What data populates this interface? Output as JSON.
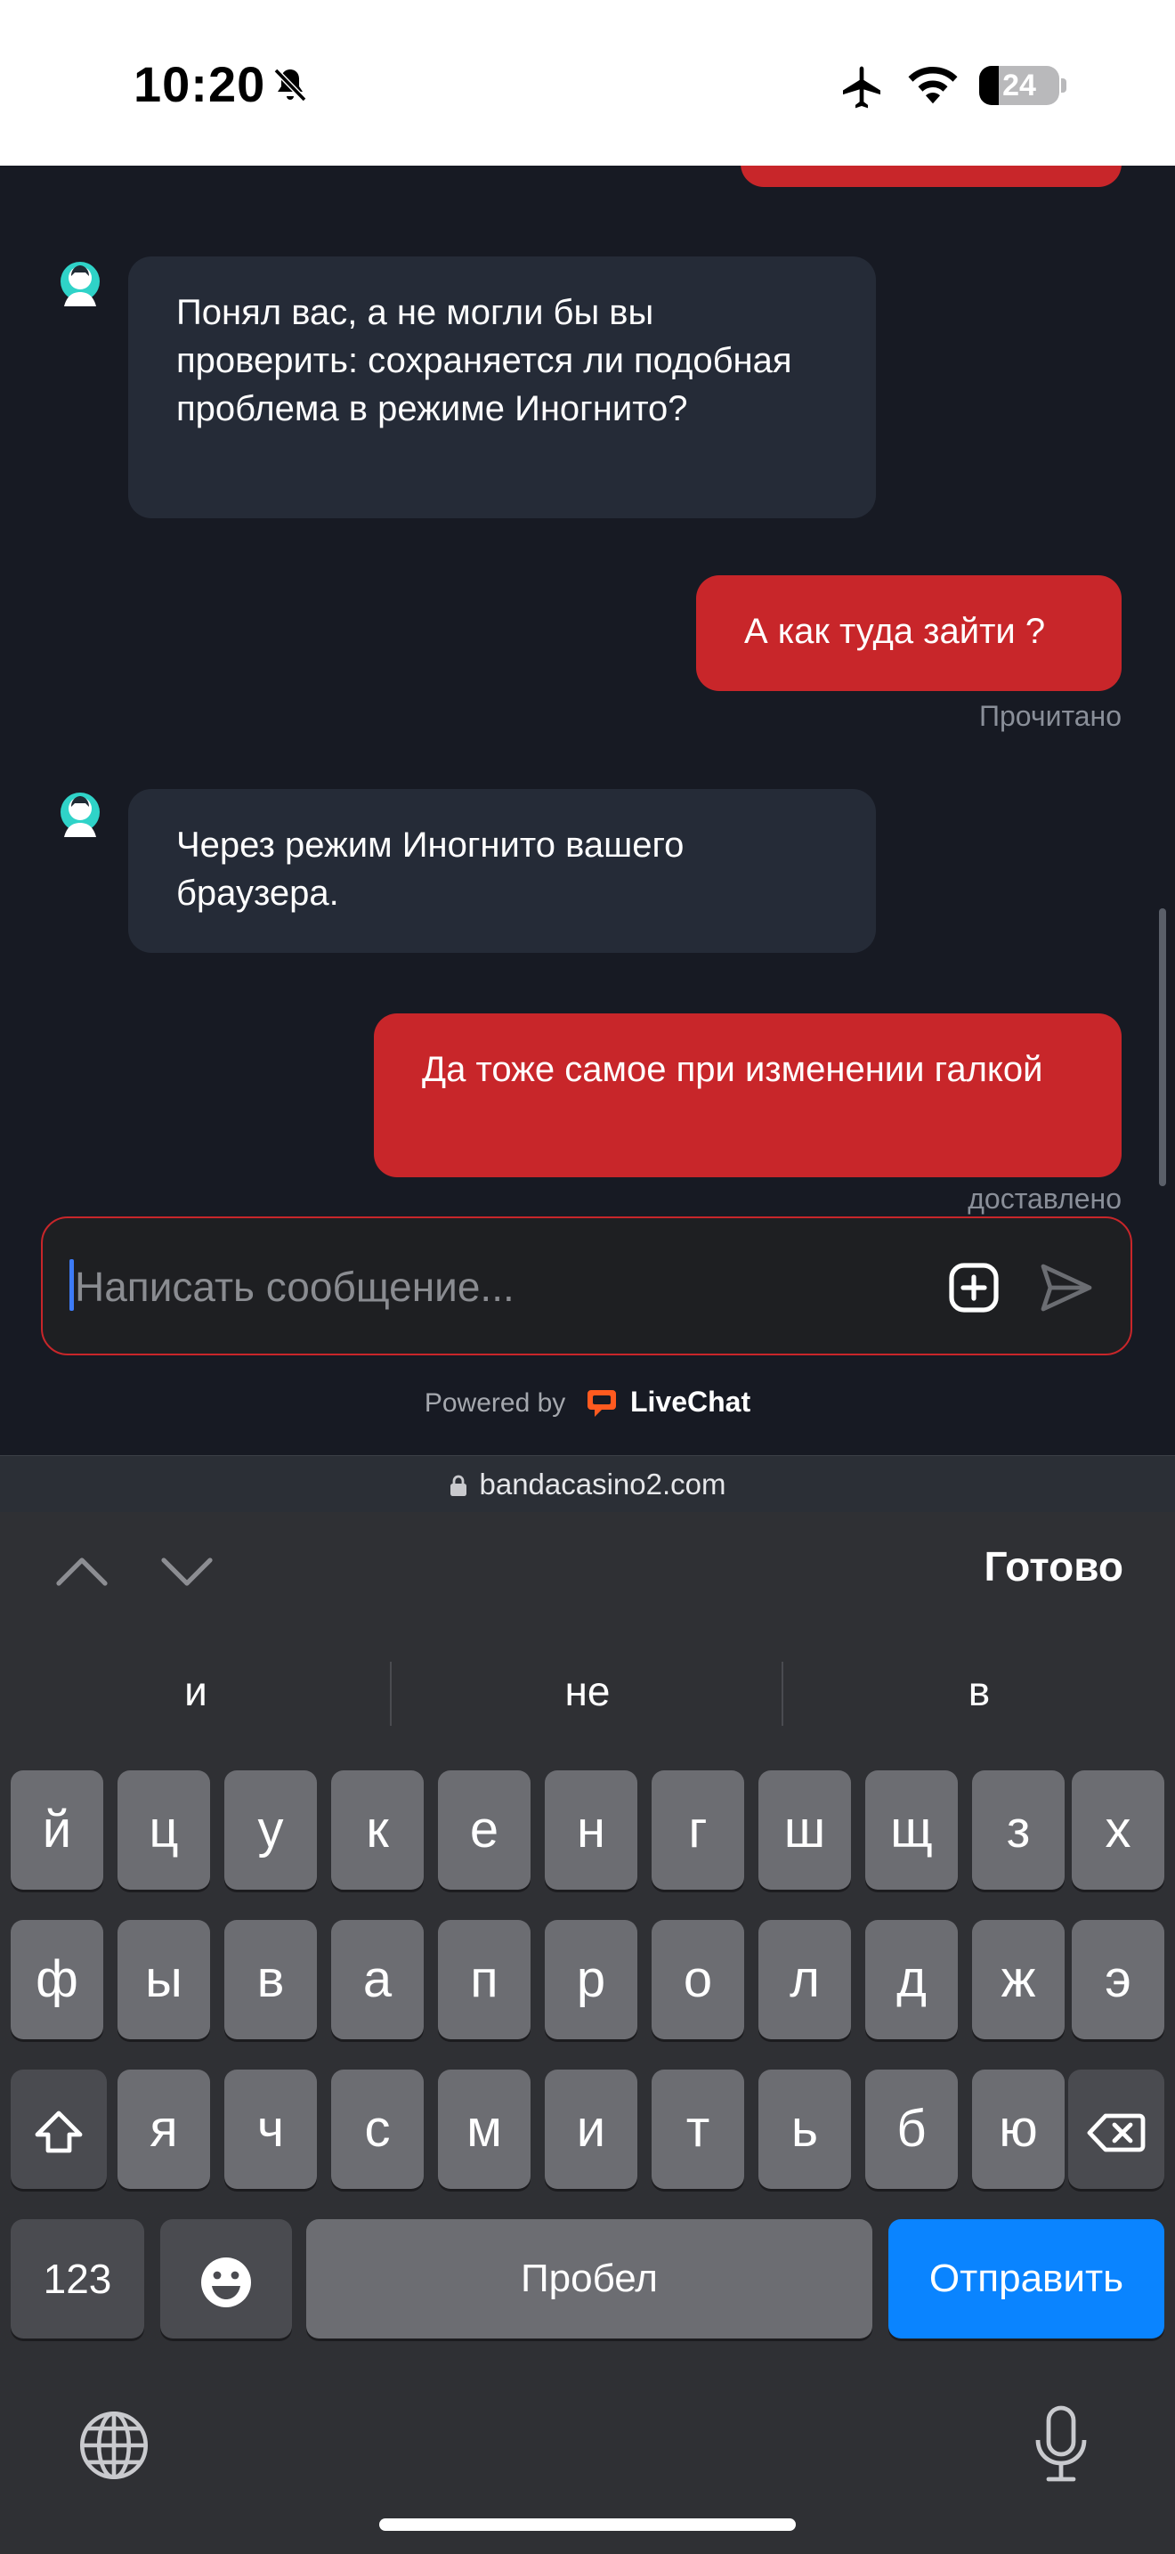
{
  "status_bar": {
    "time": "10:20",
    "battery_level": "24",
    "icons": [
      "bell-slash-icon",
      "airplane-icon",
      "wifi-icon",
      "battery-icon"
    ]
  },
  "chat": {
    "messages": [
      {
        "from": "agent",
        "text": "Понял вас, а не могли бы вы проверить: сохраняется ли подобная проблема в режиме Иногнито?"
      },
      {
        "from": "user",
        "text": "А как туда зайти ?",
        "status": "Прочитано"
      },
      {
        "from": "agent",
        "text": "Через режим Иногнито вашего браузера."
      },
      {
        "from": "user",
        "text": "Да тоже самое при изменении галкой",
        "status": "доставлено"
      }
    ]
  },
  "composer": {
    "placeholder": "Написать сообщение...",
    "attach_icon": "plus-square-icon",
    "send_icon": "send-arrow-icon"
  },
  "powered_by": {
    "prefix": "Powered by",
    "brand": "LiveChat"
  },
  "browser": {
    "url": "bandacasino2.com"
  },
  "keyboard": {
    "done_label": "Готово",
    "suggestions": [
      "и",
      "не",
      "в"
    ],
    "row1": [
      "й",
      "ц",
      "у",
      "к",
      "е",
      "н",
      "г",
      "ш",
      "щ",
      "з",
      "х"
    ],
    "row2": [
      "ф",
      "ы",
      "в",
      "а",
      "п",
      "р",
      "о",
      "л",
      "д",
      "ж",
      "э"
    ],
    "row3": [
      "я",
      "ч",
      "с",
      "м",
      "и",
      "т",
      "ь",
      "б",
      "ю"
    ],
    "numbers_label": "123",
    "space_label": "Пробел",
    "return_label": "Отправить",
    "colors": {
      "accent_red": "#c8262a",
      "return_blue": "#0a84ff"
    }
  }
}
